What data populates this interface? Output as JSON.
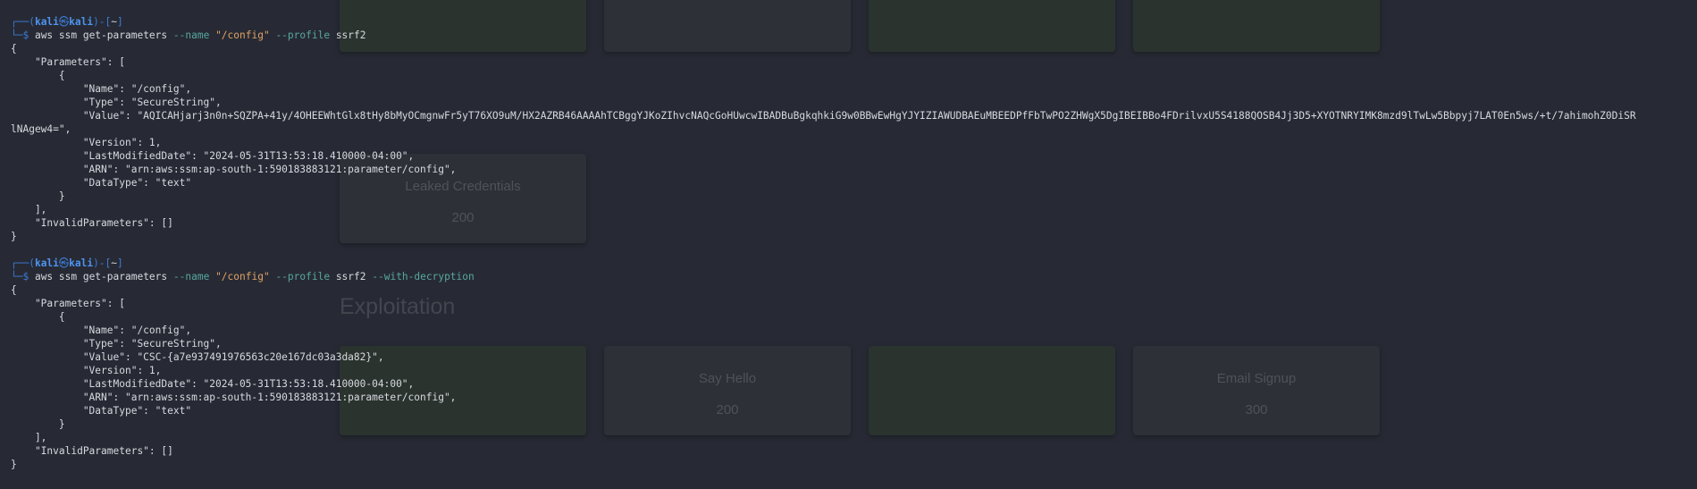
{
  "background": {
    "top_cards": [
      {
        "title": "",
        "points": "",
        "solved": true
      },
      {
        "title": "",
        "points": "",
        "solved": false
      },
      {
        "title": "",
        "points": "",
        "solved": true
      },
      {
        "title": "",
        "points": "",
        "solved": true
      }
    ],
    "mid_card": {
      "title": "Leaked Credentials",
      "points": "200"
    },
    "section_title": "Exploitation",
    "bottom_cards": [
      {
        "title": "",
        "points": "",
        "solved": true
      },
      {
        "title": "Say Hello",
        "points": "200",
        "solved": false
      },
      {
        "title": "",
        "points": "",
        "solved": true
      },
      {
        "title": "Email Signup",
        "points": "300",
        "solved": false
      }
    ]
  },
  "terminal": {
    "prompt": {
      "user": "kali",
      "host": "kali",
      "dir": "~"
    },
    "command1": {
      "cmd": "aws ssm get-parameters",
      "name_flag": "--name",
      "name_value": "\"/config\"",
      "profile_flag": "--profile",
      "profile_value": "ssrf2"
    },
    "output1": [
      "{",
      "    \"Parameters\": [",
      "        {",
      "            \"Name\": \"/config\",",
      "            \"Type\": \"SecureString\",",
      "            \"Value\": \"AQICAHjarj3n0n+SQZPA+41y/4OHEEWhtGlx8tHy8bMyOCmgnwFr5yT76XO9uM/HX2AZRB46AAAAhTCBggYJKoZIhvcNAQcGoHUwcwIBADBuBgkqhkiG9w0BBwEwHgYJYIZIAWUDBAEuMBEEDPfFbTwPO2ZHWgX5DgIBEIBBo4FDrilvxU5S4188QOSB4Jj3D5+XYOTNRYIMK8mzd9lTwLw5Bbpyj7LAT0En5ws/+t/7ahimohZ0DiSR",
      "lNAgew4=\",",
      "            \"Version\": 1,",
      "            \"LastModifiedDate\": \"2024-05-31T13:53:18.410000-04:00\",",
      "            \"ARN\": \"arn:aws:ssm:ap-south-1:590183883121:parameter/config\",",
      "            \"DataType\": \"text\"",
      "        }",
      "    ],",
      "    \"InvalidParameters\": []",
      "}"
    ],
    "command2": {
      "cmd": "aws ssm get-parameters",
      "name_flag": "--name",
      "name_value": "\"/config\"",
      "profile_flag": "--profile",
      "profile_value": "ssrf2",
      "extra_flag": "--with-decryption"
    },
    "output2": [
      "{",
      "    \"Parameters\": [",
      "        {",
      "            \"Name\": \"/config\",",
      "            \"Type\": \"SecureString\",",
      "            \"Value\": \"CSC-{a7e937491976563c20e167dc03a3da82}\",",
      "            \"Version\": 1,",
      "            \"LastModifiedDate\": \"2024-05-31T13:53:18.410000-04:00\",",
      "            \"ARN\": \"arn:aws:ssm:ap-south-1:590183883121:parameter/config\",",
      "            \"DataType\": \"text\"",
      "        }",
      "    ],",
      "    \"InvalidParameters\": []",
      "}"
    ]
  }
}
